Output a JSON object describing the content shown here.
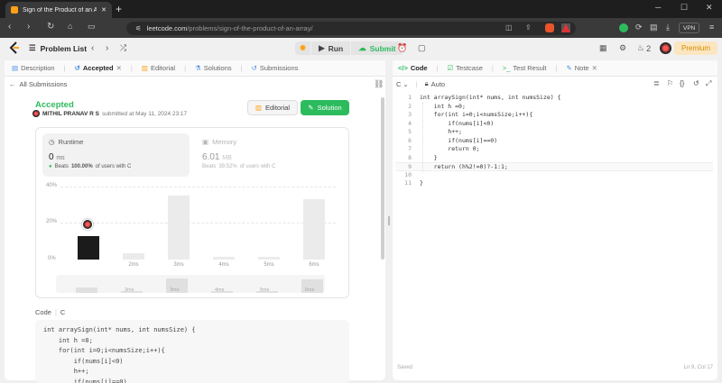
{
  "browser": {
    "tab_title": "Sign of the Product of an Array",
    "url_host": "leetcode.com",
    "url_path": "/problems/sign-of-the-product-of-an-array/",
    "vpn_label": "VPN"
  },
  "nav": {
    "problem_list": "Problem List",
    "run": "Run",
    "submit": "Submit",
    "streak": "2",
    "premium": "Premium"
  },
  "left_tabs": [
    "Description",
    "Accepted",
    "Editorial",
    "Solutions",
    "Submissions"
  ],
  "all_submissions": "All Submissions",
  "submission": {
    "status": "Accepted",
    "author": "MITHIL PRANAV R S",
    "submitted": "submitted at May 11, 2024 23:17",
    "editorial_btn": "Editorial",
    "solution_btn": "Solution"
  },
  "runtime": {
    "label": "Runtime",
    "value": "0",
    "unit": "ms",
    "beats_prefix": "Beats",
    "beats_pct": "100.00%",
    "beats_suffix": "of users with C"
  },
  "memory": {
    "label": "Memory",
    "value": "6.01",
    "unit": "MB",
    "beats_prefix": "Beats",
    "beats_pct": "39.52%",
    "beats_suffix": "of users with C"
  },
  "chart_data": {
    "type": "bar",
    "title": "",
    "xlabel": "",
    "ylabel": "",
    "y_ticks": [
      "40%",
      "20%",
      "0%"
    ],
    "ylim": [
      0,
      40
    ],
    "categories": [
      "0ms",
      "2ms",
      "3ms",
      "4ms",
      "5ms",
      "6ms"
    ],
    "x_tick_labels": [
      "",
      "2ms",
      "3ms",
      "4ms",
      "5ms",
      "6ms"
    ],
    "values": [
      13,
      3.5,
      35,
      1.5,
      1.5,
      33
    ],
    "highlight_index": 0
  },
  "mini_labels": [
    "2ms",
    "3ms",
    "4ms",
    "5ms",
    "6ms"
  ],
  "code_label": "Code",
  "code_lang": "C",
  "left_code": [
    "int arraySign(int* nums, int numsSize) {",
    "    int h =0;",
    "    for(int i=0;i<numsSize;i++){",
    "        if(nums[i]<0)",
    "        h++;",
    "        if(nums[i]==0)"
  ],
  "right_tabs": [
    "Code",
    "Testcase",
    "Test Result",
    "Note"
  ],
  "editor": {
    "lang": "C",
    "mode": "Auto",
    "lines": [
      "int arraySign(int* nums, int numsSize) {",
      "    int h =0;",
      "    for(int i=0;i<numsSize;i++){",
      "        if(nums[i]<0)",
      "        h++;",
      "        if(nums[i]==0)",
      "        return 0;",
      "    }",
      "    return (h%2!=0)?-1:1;",
      "",
      "}"
    ],
    "line_numbers": [
      "1",
      "2",
      "3",
      "4",
      "5",
      "6",
      "7",
      "8",
      "9",
      "10",
      "11"
    ],
    "status_left": "Saved",
    "status_right": "Ln 9, Col 17"
  }
}
